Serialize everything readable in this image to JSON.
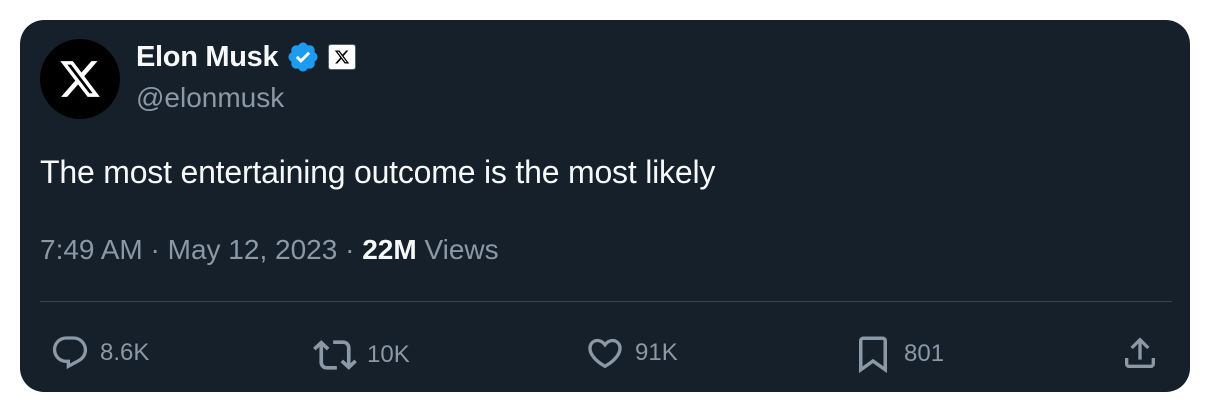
{
  "author": {
    "name": "Elon Musk",
    "handle": "@elonmusk",
    "avatar_icon": "x-logo-icon",
    "verified_icon": "verified-badge-icon",
    "verified_color": "#1d9bf0",
    "affiliate_badge_icon": "x-affiliate-icon"
  },
  "tweet": {
    "text": "The most entertaining outcome is the most likely",
    "time": "7:49 AM",
    "separator": " · ",
    "date": "May 12, 2023",
    "views_count": "22M",
    "views_label": "Views"
  },
  "actions": {
    "reply": {
      "icon": "reply-icon",
      "count": "8.6K"
    },
    "repost": {
      "icon": "repost-icon",
      "count": "10K"
    },
    "like": {
      "icon": "heart-icon",
      "count": "91K"
    },
    "bookmark": {
      "icon": "bookmark-icon",
      "count": "801"
    },
    "share": {
      "icon": "share-icon"
    }
  },
  "colors": {
    "background": "#15202b",
    "primary_text": "#f7f9f9",
    "secondary_text": "#8b98a5",
    "divider": "#38444d"
  }
}
